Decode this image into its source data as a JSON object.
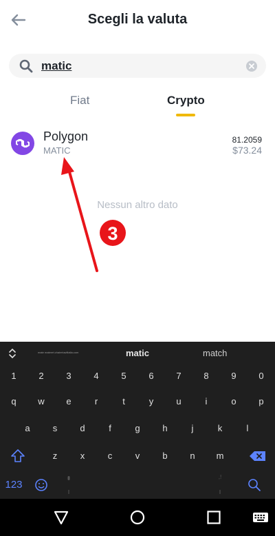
{
  "header": {
    "title": "Scegli la valuta"
  },
  "search": {
    "value": "matic"
  },
  "tabs": [
    {
      "label": "Fiat"
    },
    {
      "label": "Crypto"
    }
  ],
  "results": [
    {
      "name": "Polygon",
      "symbol": "MATIC",
      "amount": "81.2059",
      "value": "$73.24"
    }
  ],
  "empty_text": "Nessun altro dato",
  "annotation": {
    "step": "3"
  },
  "keyboard": {
    "suggestions": {
      "left": "mate materet.chaireiuwlitalia.com",
      "middle": "matic",
      "right": "match"
    },
    "numbers": [
      "1",
      "2",
      "3",
      "4",
      "5",
      "6",
      "7",
      "8",
      "9",
      "0"
    ],
    "row1": [
      "q",
      "w",
      "e",
      "r",
      "t",
      "y",
      "u",
      "i",
      "o",
      "p"
    ],
    "row2": [
      "a",
      "s",
      "d",
      "f",
      "g",
      "h",
      "j",
      "k",
      "l"
    ],
    "row3": [
      "z",
      "x",
      "c",
      "v",
      "b",
      "n",
      "m"
    ],
    "num_toggle": "123"
  },
  "colors": {
    "accent": "#f0b90b",
    "polygon": "#8247e5",
    "annotation": "#e8151a",
    "keyboard_blue": "#5c83ff"
  },
  "icons": [
    "back-arrow-icon",
    "search-icon",
    "clear-icon",
    "polygon-logo-icon",
    "expand-icon",
    "shift-icon",
    "backspace-icon",
    "emoji-icon",
    "mic-icon",
    "search-key-icon",
    "nav-back-icon",
    "nav-home-icon",
    "nav-recents-icon",
    "keyboard-icon"
  ]
}
